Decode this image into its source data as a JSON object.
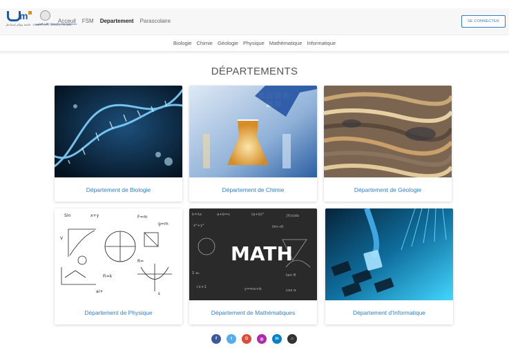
{
  "header": {
    "logo_um_text": "جامعة مولاي إسماعيل · UNIVERSITÉ MOULAY ISMAÏL",
    "logo_fsm_text": "كلية العلوم · Faculté des Sciences",
    "nav": [
      {
        "label": "Acceuil",
        "active": false
      },
      {
        "label": "FSM",
        "active": false
      },
      {
        "label": "Departement",
        "active": true
      },
      {
        "label": "Parascolaire",
        "active": false
      }
    ],
    "connect_label": "SE CONNECTER"
  },
  "subnav": [
    "Biologie",
    "Chimie",
    "Géologie",
    "Physique",
    "Mathématique",
    "Informatique"
  ],
  "title": "DÉPARTEMENTS",
  "cards": [
    {
      "caption": "Département de Biologie",
      "image": "dna-helix-image"
    },
    {
      "caption": "Département de Chimie",
      "image": "chemistry-flask-image"
    },
    {
      "caption": "Département de Géologie",
      "image": "rock-strata-image"
    },
    {
      "caption": "Département de Physique",
      "image": "physics-sketch-image"
    },
    {
      "caption": "Département de Mathématiques",
      "image": "math-chalkboard-image",
      "image_text": "MATH"
    },
    {
      "caption": "Département d'Informatique",
      "image": "network-cable-image"
    }
  ],
  "social": [
    {
      "icon": "f",
      "name": "facebook-icon",
      "color": "#3b5998"
    },
    {
      "icon": "t",
      "name": "twitter-icon",
      "color": "#55acee"
    },
    {
      "icon": "G",
      "name": "google-icon",
      "color": "#dd4b39"
    },
    {
      "icon": "◎",
      "name": "instagram-icon",
      "color": "#ac2bac"
    },
    {
      "icon": "in",
      "name": "linkedin-icon",
      "color": "#0082ca"
    },
    {
      "icon": "⌂",
      "name": "github-icon",
      "color": "#333333"
    }
  ]
}
